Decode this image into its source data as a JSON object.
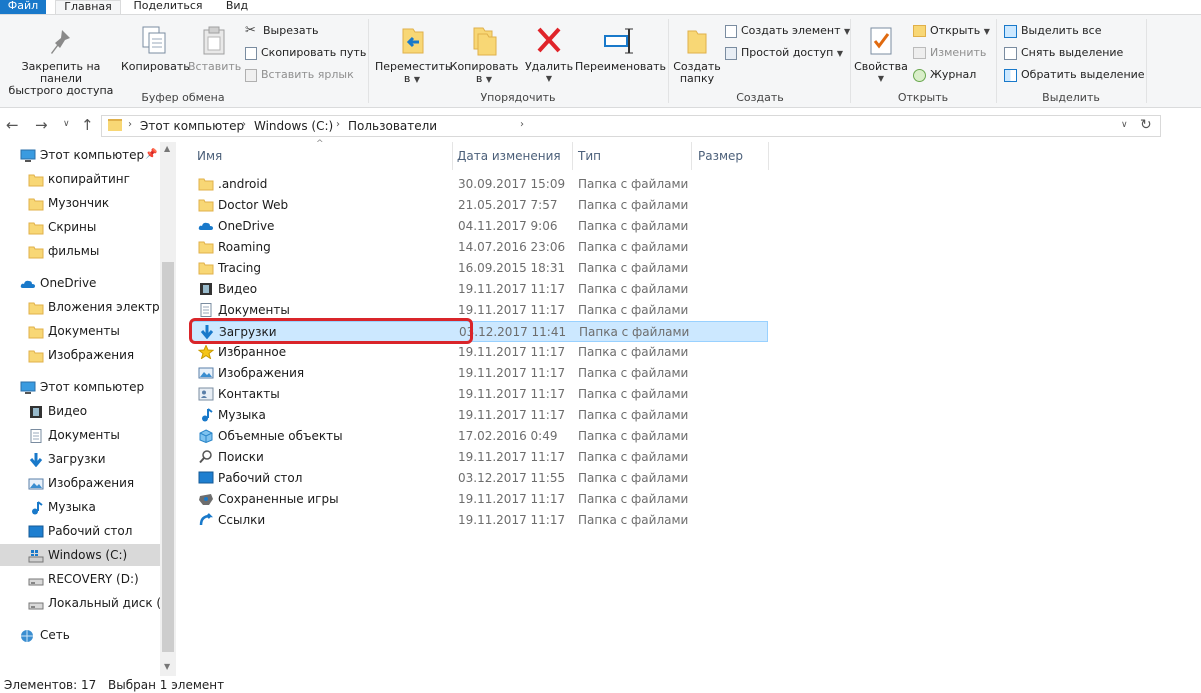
{
  "ribbon_tabs": [
    "Файл",
    "Главная",
    "Поделиться",
    "Вид"
  ],
  "ribbon": {
    "clipboard": {
      "pin_label_1": "Закрепить на панели",
      "pin_label_2": "быстрого доступа",
      "copy": "Копировать",
      "paste": "Вставить",
      "cut": "Вырезать",
      "copy_path": "Скопировать путь",
      "paste_shortcut": "Вставить ярлык",
      "group": "Буфер обмена"
    },
    "organize": {
      "move_1": "Переместить",
      "move_2": "в",
      "copyto_1": "Копировать",
      "copyto_2": "в",
      "delete": "Удалить",
      "rename": "Переименовать",
      "group": "Упорядочить"
    },
    "new": {
      "new_folder_1": "Создать",
      "new_folder_2": "папку",
      "new_item": "Создать элемент",
      "easy_access": "Простой доступ",
      "group": "Создать"
    },
    "open": {
      "properties": "Свойства",
      "open": "Открыть",
      "edit": "Изменить",
      "history": "Журнал",
      "group": "Открыть"
    },
    "select": {
      "select_all": "Выделить все",
      "select_none": "Снять выделение",
      "invert": "Обратить выделение",
      "group": "Выделить"
    }
  },
  "address": {
    "crumbs": [
      "Этот компьютер",
      "Windows (C:)",
      "Пользователи"
    ]
  },
  "sidebar": [
    {
      "label": "Этот компьютер",
      "icon": "pc-icon",
      "pinned": true
    },
    {
      "label": "копирайтинг",
      "icon": "folder-icon"
    },
    {
      "label": "Музончик",
      "icon": "folder-icon"
    },
    {
      "label": "Скрины",
      "icon": "folder-icon"
    },
    {
      "label": "фильмы",
      "icon": "folder-icon"
    },
    {
      "label": "OneDrive",
      "icon": "onedrive-icon"
    },
    {
      "label": "Вложения электрон",
      "icon": "folder-icon"
    },
    {
      "label": "Документы",
      "icon": "folder-icon"
    },
    {
      "label": "Изображения",
      "icon": "folder-icon"
    },
    {
      "label": "Этот компьютер",
      "icon": "pc-icon"
    },
    {
      "label": "Видео",
      "icon": "video-icon"
    },
    {
      "label": "Документы",
      "icon": "documents-icon"
    },
    {
      "label": "Загрузки",
      "icon": "downloads-icon"
    },
    {
      "label": "Изображения",
      "icon": "pictures-icon"
    },
    {
      "label": "Музыка",
      "icon": "music-icon"
    },
    {
      "label": "Рабочий стол",
      "icon": "desktop-icon"
    },
    {
      "label": "Windows (C:)",
      "icon": "drive-c-icon"
    },
    {
      "label": "RECOVERY (D:)",
      "icon": "drive-icon"
    },
    {
      "label": "Локальный диск (F:)",
      "icon": "drive-icon"
    },
    {
      "label": "Сеть",
      "icon": "network-icon"
    }
  ],
  "columns": {
    "name": "Имя",
    "date": "Дата изменения",
    "type": "Тип",
    "size": "Размер"
  },
  "files": [
    {
      "name": ".android",
      "date": "30.09.2017 15:09",
      "type": "Папка с файлами",
      "icon": "folder-icon"
    },
    {
      "name": "Doctor Web",
      "date": "21.05.2017 7:57",
      "type": "Папка с файлами",
      "icon": "folder-icon"
    },
    {
      "name": "OneDrive",
      "date": "04.11.2017 9:06",
      "type": "Папка с файлами",
      "icon": "onedrive-icon"
    },
    {
      "name": "Roaming",
      "date": "14.07.2016 23:06",
      "type": "Папка с файлами",
      "icon": "folder-icon"
    },
    {
      "name": "Tracing",
      "date": "16.09.2015 18:31",
      "type": "Папка с файлами",
      "icon": "folder-icon"
    },
    {
      "name": "Видео",
      "date": "19.11.2017 11:17",
      "type": "Папка с файлами",
      "icon": "video-icon"
    },
    {
      "name": "Документы",
      "date": "19.11.2017 11:17",
      "type": "Папка с файлами",
      "icon": "documents-icon"
    },
    {
      "name": "Загрузки",
      "date": "03.12.2017 11:41",
      "type": "Папка с файлами",
      "icon": "downloads-icon"
    },
    {
      "name": "Избранное",
      "date": "19.11.2017 11:17",
      "type": "Папка с файлами",
      "icon": "favorites-icon"
    },
    {
      "name": "Изображения",
      "date": "19.11.2017 11:17",
      "type": "Папка с файлами",
      "icon": "pictures-icon"
    },
    {
      "name": "Контакты",
      "date": "19.11.2017 11:17",
      "type": "Папка с файлами",
      "icon": "contacts-icon"
    },
    {
      "name": "Музыка",
      "date": "19.11.2017 11:17",
      "type": "Папка с файлами",
      "icon": "music-icon"
    },
    {
      "name": "Объемные объекты",
      "date": "17.02.2016 0:49",
      "type": "Папка с файлами",
      "icon": "3d-objects-icon"
    },
    {
      "name": "Поиски",
      "date": "19.11.2017 11:17",
      "type": "Папка с файлами",
      "icon": "searches-icon"
    },
    {
      "name": "Рабочий стол",
      "date": "03.12.2017 11:55",
      "type": "Папка с файлами",
      "icon": "desktop-icon"
    },
    {
      "name": "Сохраненные игры",
      "date": "19.11.2017 11:17",
      "type": "Папка с файлами",
      "icon": "saved-games-icon"
    },
    {
      "name": "Ссылки",
      "date": "19.11.2017 11:17",
      "type": "Папка с файлами",
      "icon": "links-icon"
    }
  ],
  "selected_file": "Загрузки",
  "status": {
    "count": "Элементов: 17",
    "selected": "Выбран 1 элемент"
  },
  "colors": {
    "accent": "#1979ca",
    "selection": "#cce8ff",
    "highlight_ring": "#d9252a"
  }
}
